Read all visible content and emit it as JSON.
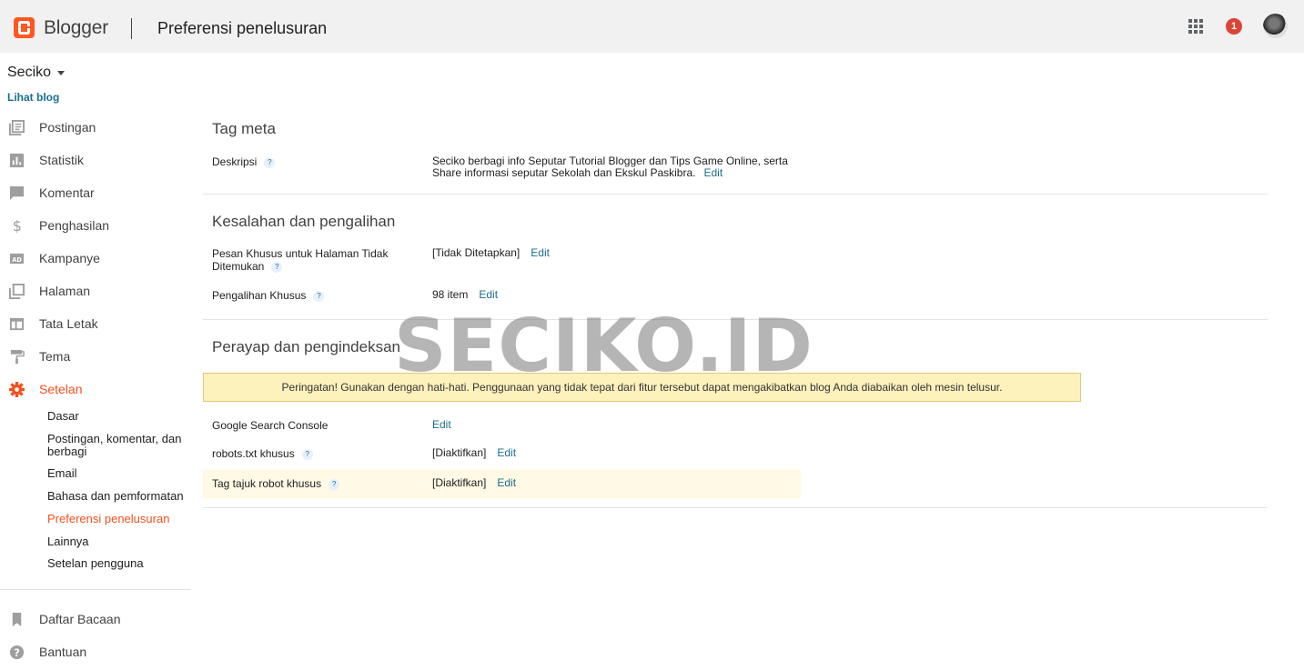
{
  "header": {
    "logo_text": "Blogger",
    "page_title": "Preferensi penelusuran",
    "notification_count": "1",
    "brand_color": "#ff5722"
  },
  "sidebar": {
    "blog_name": "Seciko",
    "view_blog": "Lihat blog",
    "items": [
      {
        "label": "Postingan",
        "icon": "posts-icon"
      },
      {
        "label": "Statistik",
        "icon": "stats-icon"
      },
      {
        "label": "Komentar",
        "icon": "comment-icon"
      },
      {
        "label": "Penghasilan",
        "icon": "dollar-icon"
      },
      {
        "label": "Kampanye",
        "icon": "ad-icon"
      },
      {
        "label": "Halaman",
        "icon": "pages-icon"
      },
      {
        "label": "Tata Letak",
        "icon": "layout-icon"
      },
      {
        "label": "Tema",
        "icon": "paint-roller-icon"
      },
      {
        "label": "Setelan",
        "icon": "gear-icon",
        "active": true
      }
    ],
    "sub_items": [
      {
        "label": "Dasar"
      },
      {
        "label": "Postingan, komentar, dan berbagi"
      },
      {
        "label": "Email"
      },
      {
        "label": "Bahasa dan pemformatan"
      },
      {
        "label": "Preferensi penelusuran",
        "active": true
      },
      {
        "label": "Lainnya"
      },
      {
        "label": "Setelan pengguna"
      }
    ],
    "bottom_items": [
      {
        "label": "Daftar Bacaan",
        "icon": "bookmark-icon"
      },
      {
        "label": "Bantuan",
        "icon": "help-icon"
      }
    ],
    "active_color": "#f4511e"
  },
  "main": {
    "meta": {
      "title": "Tag meta",
      "description_label": "Deskripsi",
      "description_value_line1": "Seciko berbagi info Seputar Tutorial Blogger dan Tips Game Online, serta",
      "description_value_line2": "Share informasi seputar Sekolah dan Ekskul Paskibra.",
      "edit": "Edit"
    },
    "errors": {
      "title": "Kesalahan dan pengalihan",
      "notfound_label_line1": "Pesan Khusus untuk Halaman Tidak",
      "notfound_label_line2": "Ditemukan",
      "notfound_value": "[Tidak Ditetapkan]",
      "redirect_label": "Pengalihan Khusus",
      "redirect_value": "98 item",
      "edit": "Edit"
    },
    "crawl": {
      "title": "Perayap dan pengindeksan",
      "warning": "Peringatan! Gunakan dengan hati-hati. Penggunaan yang tidak tepat dari fitur tersebut dapat mengakibatkan blog Anda diabaikan oleh mesin telusur.",
      "gsc_label": "Google Search Console",
      "robots_label": "robots.txt khusus",
      "robots_value": "[Diaktifkan]",
      "robot_tags_label": "Tag tajuk robot khusus",
      "robot_tags_value": "[Diaktifkan]",
      "edit": "Edit"
    },
    "help_glyph": "?",
    "link_color": "#1a6d8f"
  },
  "watermark": "SECIKO.ID"
}
